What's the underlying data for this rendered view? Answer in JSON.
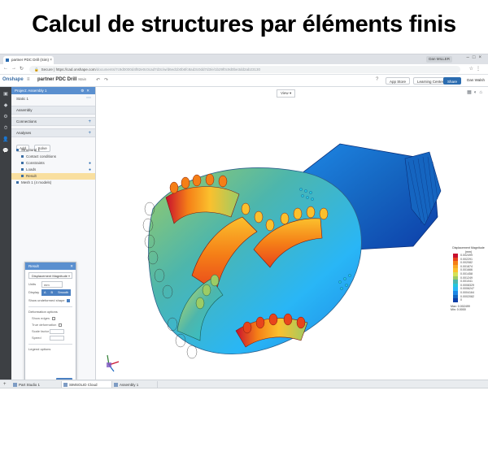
{
  "headline": "Calcul de structures par éléments finis",
  "browser": {
    "tab_title": "partner PDC Drill (Sim)",
    "user_chip": "Dan MILLER",
    "address": {
      "secure_label": "Secure",
      "host": "https://cad.onshape.com",
      "path": "/documents/7c9d0000d4f82e0c0cad7d3c/w/d6ed1b0b6fc8ad3c0dd7d3/e/1b29f0c9d0be3dd2ab23130"
    }
  },
  "app": {
    "brand": "Onshape",
    "doc_title": "partner PDC Drill",
    "doc_branch": "Main",
    "buttons": {
      "app_store": "App Store",
      "learning": "Learning Center",
      "share": "Share"
    },
    "user": "Dan Walsh"
  },
  "panel": {
    "header": "Project: Assembly 1",
    "mode": "Static 1",
    "sections": {
      "assembly": "Assembly",
      "connections": "Connections",
      "analyses": "Analyses"
    },
    "add_label": "Add",
    "solve_label": "Solve",
    "tree": {
      "study": "Structural 1",
      "items": [
        "Contact conditions",
        "Constraints",
        "Loads",
        "Result"
      ],
      "selected_index": 3,
      "mesh": "Mesh 1 (4 models)"
    }
  },
  "result_dialog": {
    "title": "Result",
    "result_type": "Displacement Magnitude",
    "units_label": "Units",
    "units_value": "mm",
    "display_label": "Display",
    "display_options": [
      "A",
      "B",
      "Smooth"
    ],
    "undeformed_label": "Show undeformed shape",
    "deformation_header": "Deformation options",
    "show_edges_label": "Show edges",
    "animation_label": "True deformation",
    "scale_label": "Scale factor",
    "speed_label": "Speed",
    "legend_header": "Legend options",
    "done_label": "Done"
  },
  "viewport": {
    "view_dropdown": "View",
    "legend": {
      "title": "Displacement Magnitude (mm)",
      "values": [
        "0.002499",
        "0.002291",
        "0.002082",
        "0.001874",
        "0.001666",
        "0.001458",
        "0.001249",
        "0.001041",
        "0.0008329",
        "0.0006247",
        "0.0004164",
        "0.0002082",
        "0"
      ],
      "max": "Max: 0.002499",
      "min": "Min: 0.0000"
    },
    "colors": {
      "scale": [
        "#c8102e",
        "#e8451c",
        "#f57f17",
        "#f9a825",
        "#fbc02d",
        "#d4e157",
        "#9ccc65",
        "#4db6ac",
        "#26c6da",
        "#29b6f6",
        "#1e88e5",
        "#1565c0",
        "#0d3ea8"
      ]
    }
  },
  "bottom_tabs": [
    "Part Studio 1",
    "SIMSOLID Cloud",
    "Assembly 1"
  ],
  "bottom_active_index": 1
}
